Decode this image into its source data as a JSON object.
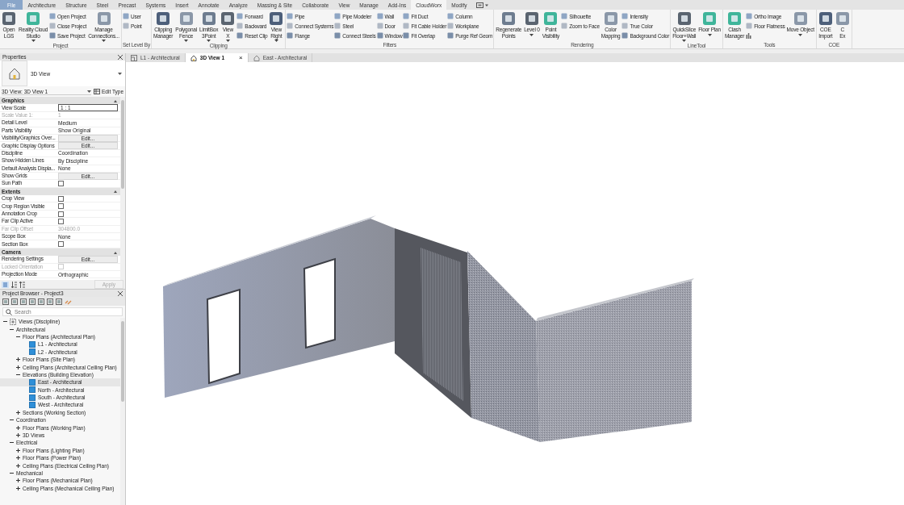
{
  "menu_tabs": [
    {
      "label": "File",
      "kind": "file",
      "selected": false
    },
    {
      "label": "Architecture",
      "kind": "tab",
      "selected": false
    },
    {
      "label": "Structure",
      "kind": "tab",
      "selected": false
    },
    {
      "label": "Steel",
      "kind": "tab",
      "selected": false
    },
    {
      "label": "Precast",
      "kind": "tab",
      "selected": false
    },
    {
      "label": "Systems",
      "kind": "tab",
      "selected": false
    },
    {
      "label": "Insert",
      "kind": "tab",
      "selected": false
    },
    {
      "label": "Annotate",
      "kind": "tab",
      "selected": false
    },
    {
      "label": "Analyze",
      "kind": "tab",
      "selected": false
    },
    {
      "label": "Massing & Site",
      "kind": "tab",
      "selected": false
    },
    {
      "label": "Collaborate",
      "kind": "tab",
      "selected": false
    },
    {
      "label": "View",
      "kind": "tab",
      "selected": false
    },
    {
      "label": "Manage",
      "kind": "tab",
      "selected": false
    },
    {
      "label": "Add-Ins",
      "kind": "tab",
      "selected": false
    },
    {
      "label": "CloudWorx",
      "kind": "tab",
      "selected": true
    },
    {
      "label": "Modify",
      "kind": "tab",
      "selected": false
    },
    {
      "kind": "icon-menu",
      "selected": false
    }
  ],
  "ribbon": [
    {
      "label": "Project",
      "columns": [
        {
          "kind": "large",
          "label": "Open\nLGS",
          "dropdown": false
        },
        {
          "kind": "large",
          "label": "Reality Cloud\nStudio",
          "dropdown": true
        },
        {
          "kind": "stack",
          "items": [
            {
              "label": "Open Project"
            },
            {
              "label": "Close Project"
            },
            {
              "label": "Save Project"
            }
          ]
        },
        {
          "kind": "large",
          "label": "Manage\nConnections...",
          "dropdown": true
        }
      ]
    },
    {
      "label": "Set Level By",
      "columns": [
        {
          "kind": "stack",
          "items": [
            {
              "label": "User"
            },
            {
              "label": "Point"
            }
          ]
        }
      ]
    },
    {
      "label": "Clipping",
      "columns": [
        {
          "kind": "large",
          "label": "Clipping\nManager",
          "dropdown": false
        },
        {
          "kind": "large",
          "label": "Polygonal\nFence",
          "dropdown": true
        },
        {
          "kind": "large",
          "label": "LimitBox\n3Point",
          "dropdown": true
        },
        {
          "kind": "large",
          "label": "View\nX",
          "dropdown": true
        },
        {
          "kind": "stack",
          "items": [
            {
              "label": "Forward"
            },
            {
              "label": "Backward"
            },
            {
              "label": "Reset Clip"
            }
          ]
        },
        {
          "kind": "large",
          "label": "View\nRight",
          "dropdown": true
        }
      ]
    },
    {
      "label": "Fitters",
      "columns": [
        {
          "kind": "stack",
          "items": [
            {
              "label": "Pipe"
            },
            {
              "label": "Connect Systems"
            },
            {
              "label": "Flange"
            }
          ]
        },
        {
          "kind": "stack",
          "items": [
            {
              "label": "Pipe Modeler"
            },
            {
              "label": "Steel"
            },
            {
              "label": "Connect Steels"
            }
          ]
        },
        {
          "kind": "stack",
          "items": [
            {
              "label": "Wall"
            },
            {
              "label": "Door"
            },
            {
              "label": "Window"
            }
          ]
        },
        {
          "kind": "stack",
          "items": [
            {
              "label": "Fit Duct"
            },
            {
              "label": "Fit Cable Holder"
            },
            {
              "label": "Fit Overlap"
            }
          ]
        },
        {
          "kind": "stack",
          "items": [
            {
              "label": "Column"
            },
            {
              "label": "Workplane"
            },
            {
              "label": "Purge Ref Geom"
            }
          ]
        }
      ]
    },
    {
      "label": "Rendering",
      "columns": [
        {
          "kind": "large",
          "label": "Regenerate\nPoints",
          "dropdown": false
        },
        {
          "kind": "large",
          "label": "Level 0",
          "dropdown": true
        },
        {
          "kind": "large",
          "label": "Point\nVisibility",
          "dropdown": false
        },
        {
          "kind": "stack",
          "items": [
            {
              "label": "Silhouette"
            },
            {
              "label": "Zoom to Face"
            }
          ]
        },
        {
          "kind": "large",
          "label": "Color\nMapping",
          "dropdown": false
        },
        {
          "kind": "stack",
          "items": [
            {
              "label": "Intensity"
            },
            {
              "label": "True Color"
            },
            {
              "label": "Background Color"
            }
          ]
        }
      ]
    },
    {
      "label": "LineTool",
      "columns": [
        {
          "kind": "large",
          "label": "QuickSlice\nFloor+Wall",
          "dropdown": true
        },
        {
          "kind": "large",
          "label": "Floor Plan",
          "dropdown": true
        }
      ]
    },
    {
      "label": "Tools",
      "columns": [
        {
          "kind": "large",
          "label": "Clash\nManager",
          "dropdown": false
        },
        {
          "kind": "stack",
          "items": [
            {
              "kind": "text",
              "label": "Ortho Image"
            },
            {
              "kind": "text",
              "label": "Floor Flatness"
            },
            {
              "kind": "icon"
            }
          ]
        },
        {
          "kind": "large",
          "label": "Move Object",
          "dropdown": true
        }
      ]
    },
    {
      "label": "COE",
      "columns": [
        {
          "kind": "large",
          "label": "COE\nImport",
          "dropdown": false
        },
        {
          "kind": "large",
          "label": "C\nEx",
          "dropdown": false
        }
      ]
    }
  ],
  "properties": {
    "title": "Properties",
    "type_name": "3D View",
    "selector": "3D View: 3D View 1",
    "edit_type": "Edit Type",
    "sections": [
      {
        "name": "Graphics",
        "rows": [
          {
            "label": "View Scale",
            "kind": "field",
            "value": "1 : 1",
            "disabled": false
          },
          {
            "label": "Scale Value    1:",
            "kind": "text",
            "value": "1",
            "disabled": true
          },
          {
            "label": "Detail Level",
            "kind": "text",
            "value": "Medium",
            "disabled": false
          },
          {
            "label": "Parts Visibility",
            "kind": "text",
            "value": "Show Original",
            "disabled": false
          },
          {
            "label": "Visibility/Graphics Over...",
            "kind": "button",
            "value": "Edit...",
            "disabled": false
          },
          {
            "label": "Graphic Display Options",
            "kind": "button",
            "value": "Edit...",
            "disabled": false
          },
          {
            "label": "Discipline",
            "kind": "text",
            "value": "Coordination",
            "disabled": false
          },
          {
            "label": "Show Hidden Lines",
            "kind": "text",
            "value": "By Discipline",
            "disabled": false
          },
          {
            "label": "Default Analysis Displa...",
            "kind": "text",
            "value": "None",
            "disabled": false
          },
          {
            "label": "Show Grids",
            "kind": "button",
            "value": "Edit...",
            "disabled": false
          },
          {
            "label": "Sun Path",
            "kind": "check",
            "checked": false,
            "disabled": false
          }
        ]
      },
      {
        "name": "Extents",
        "rows": [
          {
            "label": "Crop View",
            "kind": "check",
            "checked": false,
            "disabled": false
          },
          {
            "label": "Crop Region Visible",
            "kind": "check",
            "checked": false,
            "disabled": false
          },
          {
            "label": "Annotation Crop",
            "kind": "check",
            "checked": false,
            "disabled": false
          },
          {
            "label": "Far Clip Active",
            "kind": "check",
            "checked": false,
            "disabled": false
          },
          {
            "label": "Far Clip Offset",
            "kind": "text",
            "value": "304800.0",
            "disabled": true
          },
          {
            "label": "Scope Box",
            "kind": "text",
            "value": "None",
            "disabled": false
          },
          {
            "label": "Section Box",
            "kind": "check",
            "checked": false,
            "disabled": false
          }
        ]
      },
      {
        "name": "Camera",
        "rows": [
          {
            "label": "Rendering Settings",
            "kind": "button",
            "value": "Edit...",
            "disabled": false
          },
          {
            "label": "Locked Orientation",
            "kind": "check",
            "checked": false,
            "disabled": true
          },
          {
            "label": "Projection Mode",
            "kind": "text",
            "value": "Orthographic",
            "disabled": false
          }
        ]
      }
    ],
    "apply": {
      "label": "Apply",
      "disabled": true
    }
  },
  "project_browser": {
    "title": "Project Browser - Project3",
    "search_placeholder": "Search",
    "tree": [
      {
        "label": "Views (Discipline)",
        "kind": "root",
        "expanded": true,
        "selected": false,
        "children": [
          {
            "label": "Architectural",
            "kind": "group",
            "expanded": true,
            "selected": false,
            "children": [
              {
                "label": "Floor Plans (Architectural Plan)",
                "kind": "group",
                "expanded": true,
                "selected": false,
                "children": [
                  {
                    "label": "L1 - Architectural",
                    "kind": "view",
                    "selected": false
                  },
                  {
                    "label": "L2 - Architectural",
                    "kind": "view",
                    "selected": false
                  }
                ]
              },
              {
                "label": "Floor Plans (Site Plan)",
                "kind": "group",
                "expanded": false,
                "selected": false
              },
              {
                "label": "Ceiling Plans (Architectural Ceiling Plan)",
                "kind": "group",
                "expanded": false,
                "selected": false
              },
              {
                "label": "Elevations (Building Elevation)",
                "kind": "group",
                "expanded": true,
                "selected": false,
                "children": [
                  {
                    "label": "East - Architectural",
                    "kind": "view",
                    "selected": true
                  },
                  {
                    "label": "North - Architectural",
                    "kind": "view",
                    "selected": false
                  },
                  {
                    "label": "South - Architectural",
                    "kind": "view",
                    "selected": false
                  },
                  {
                    "label": "West - Architectural",
                    "kind": "view",
                    "selected": false
                  }
                ]
              },
              {
                "label": "Sections (Working Section)",
                "kind": "group",
                "expanded": false,
                "selected": false
              }
            ]
          },
          {
            "label": "Coordination",
            "kind": "group",
            "expanded": true,
            "selected": false,
            "children": [
              {
                "label": "Floor Plans (Working Plan)",
                "kind": "group",
                "expanded": false,
                "selected": false
              },
              {
                "label": "3D Views",
                "kind": "group",
                "expanded": false,
                "selected": false
              }
            ]
          },
          {
            "label": "Electrical",
            "kind": "group",
            "expanded": true,
            "selected": false,
            "children": [
              {
                "label": "Floor Plans (Lighting Plan)",
                "kind": "group",
                "expanded": false,
                "selected": false
              },
              {
                "label": "Floor Plans (Power Plan)",
                "kind": "group",
                "expanded": false,
                "selected": false
              },
              {
                "label": "Ceiling Plans (Electrical Ceiling Plan)",
                "kind": "group",
                "expanded": false,
                "selected": false
              }
            ]
          },
          {
            "label": "Mechanical",
            "kind": "group",
            "expanded": true,
            "selected": false,
            "children": [
              {
                "label": "Floor Plans (Mechanical Plan)",
                "kind": "group",
                "expanded": false,
                "selected": false
              },
              {
                "label": "Ceiling Plans (Mechanical Ceiling Plan)",
                "kind": "group",
                "expanded": false,
                "selected": false
              }
            ]
          }
        ]
      }
    ]
  },
  "view_tabs": [
    {
      "label": "L1 - Architectural",
      "kind": "plan",
      "selected": false
    },
    {
      "label": "3D View 1",
      "kind": "model",
      "selected": true,
      "close": "×"
    },
    {
      "label": "East - Architectural",
      "kind": "elevation",
      "selected": false
    }
  ]
}
